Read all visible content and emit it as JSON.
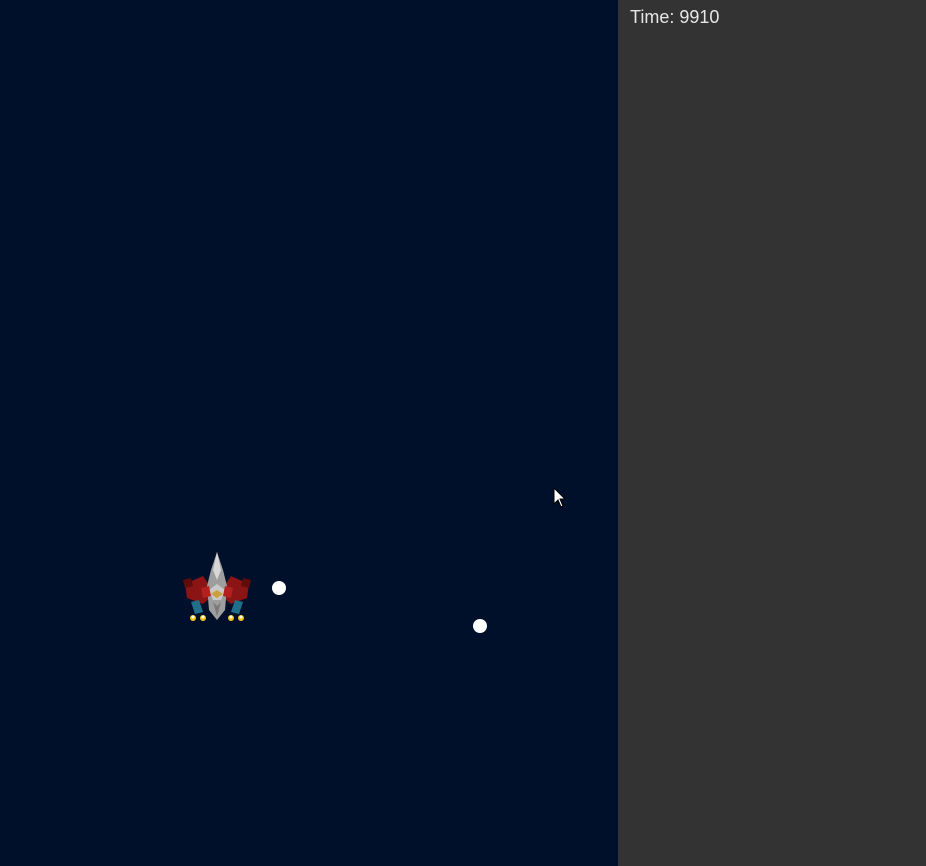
{
  "hud": {
    "time_label": "Time: 9910"
  },
  "colors": {
    "space_background": "#00102b",
    "side_panel": "#333333",
    "hud_text": "#e6e6e6",
    "bullet": "#ffffff"
  },
  "icons": {
    "player": "player-ship-icon",
    "projectile": "bullet-icon",
    "pointer": "mouse-cursor-icon"
  }
}
